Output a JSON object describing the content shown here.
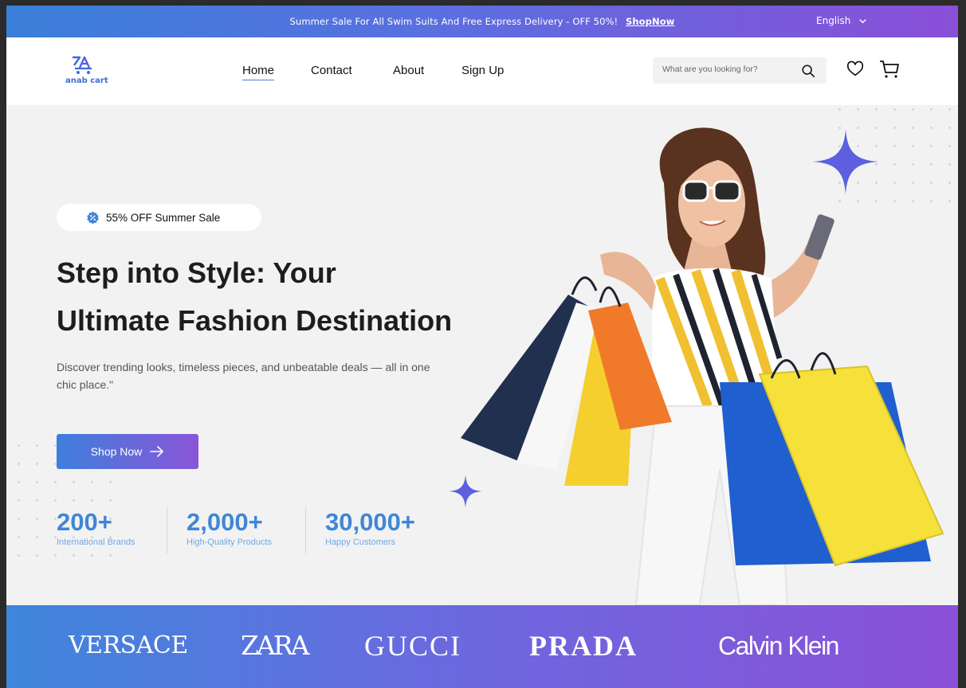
{
  "top_banner": {
    "message": "Summer Sale For All Swim Suits And Free Express Delivery - OFF 50%!",
    "link": "ShopNow",
    "language": "English"
  },
  "header": {
    "logo_text": "anab cart",
    "nav": [
      {
        "label": "Home",
        "active": true
      },
      {
        "label": "Contact"
      },
      {
        "label": "About"
      },
      {
        "label": "Sign Up"
      }
    ],
    "search_placeholder": "What are you looking for?",
    "icons": [
      "search-icon",
      "heart-icon",
      "cart-icon"
    ]
  },
  "hero": {
    "badge": "55% OFF Summer Sale",
    "headline_line1": "Step into Style: Your",
    "headline_line2": "Ultimate Fashion Destination",
    "description": "Discover trending looks, timeless pieces, and unbeatable deals — all in one chic place.\"",
    "cta": "Shop Now",
    "stats": [
      {
        "value": "200+",
        "label": "International Brands"
      },
      {
        "value": "2,000+",
        "label": "High-Quality Products"
      },
      {
        "value": "30,000+",
        "label": "Happy Customers"
      }
    ]
  },
  "brands": [
    "VERSACE",
    "ZARA",
    "GUCCI",
    "PRADA",
    "Calvin Klein"
  ],
  "colors": {
    "accent_blue": "#3f86d8",
    "accent_purple": "#8a55d8",
    "sparkle": "#5b5fe0"
  }
}
